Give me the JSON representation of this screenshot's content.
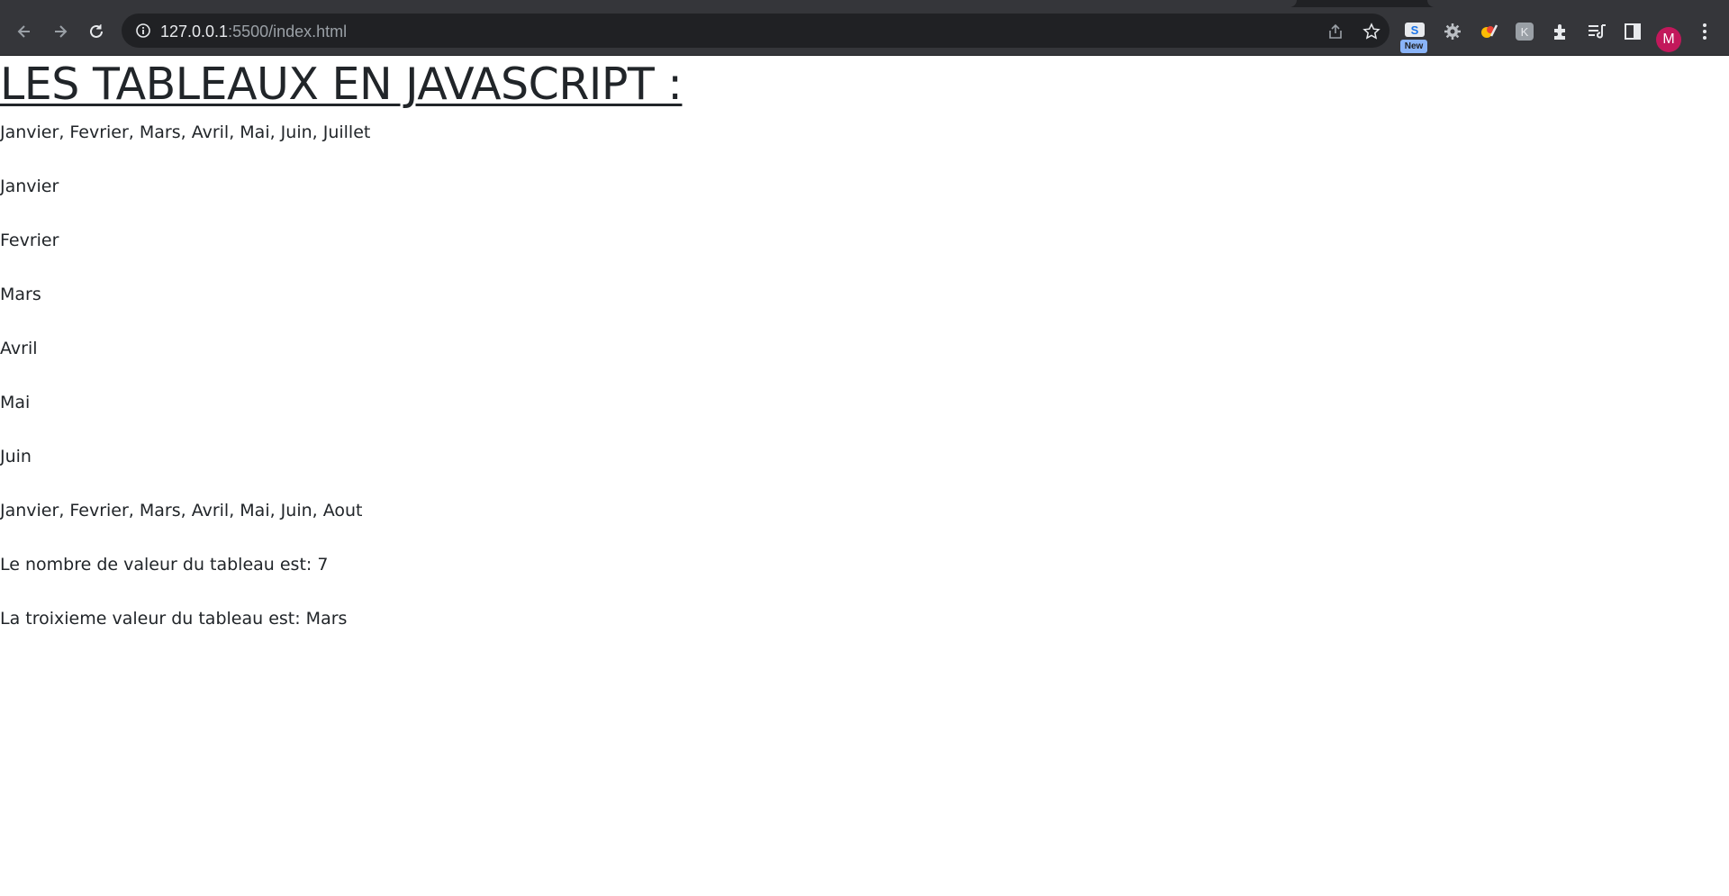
{
  "browser": {
    "url_host": "127.0.0.1",
    "url_path": ":5500/index.html",
    "extension_badge": "New",
    "profile_initial": "M",
    "icons": [
      "back-icon",
      "forward-icon",
      "reload-icon",
      "site-info-icon",
      "share-icon",
      "bookmark-star-icon",
      "extension-s-icon",
      "extension-gear-icon",
      "extension-colorpicker-icon",
      "extension-k-icon",
      "extensions-puzzle-icon",
      "reading-list-icon",
      "side-panel-icon",
      "menu-kebab-icon"
    ],
    "colors": {
      "toolbar": "#35363a",
      "omnibox": "#202124",
      "avatar": "#c2185b"
    }
  },
  "page": {
    "heading": "LES TABLEAUX EN JAVASCRIPT :",
    "lines": [
      "Janvier, Fevrier, Mars, Avril, Mai, Juin, Juillet",
      "Janvier",
      "Fevrier",
      "Mars",
      "Avril",
      "Mai",
      "Juin",
      "Janvier, Fevrier, Mars, Avril, Mai, Juin, Aout",
      "Le nombre de valeur du tableau est: 7",
      "La troixieme valeur du tableau est: Mars"
    ]
  }
}
